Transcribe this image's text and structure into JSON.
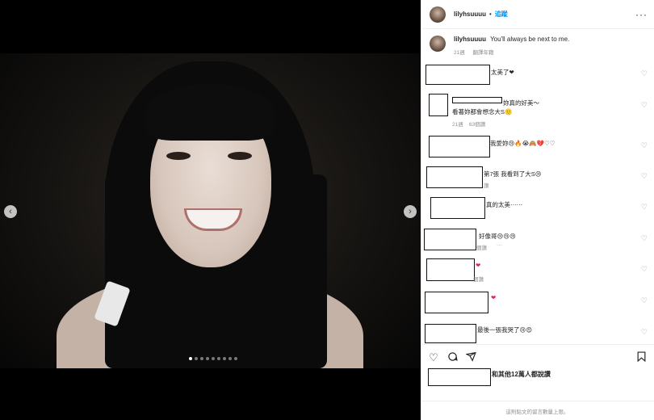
{
  "media": {
    "nav": {
      "prev_icon": "chevron-left-icon",
      "next_icon": "chevron-right-icon",
      "prev": "‹",
      "next": "›"
    },
    "carousel": {
      "count": 9,
      "active_index": 0
    }
  },
  "header": {
    "username": "lilyhsuuuu",
    "separator": "•",
    "follow_label": "追蹤",
    "more": "···"
  },
  "caption": {
    "username": "lilyhsuuuu",
    "text": "You'll always be next to me.",
    "age": "21週",
    "translate": "翻譯年籍"
  },
  "comments": [
    {
      "text": "太美了❤",
      "meta": ""
    },
    {
      "text": "妳真的好美～",
      "text2": "看著妳都會想念大S🙂",
      "meta_age": "21週",
      "meta_likes": "63個讚"
    },
    {
      "text": "我愛妳😢🔥😭🙈💔♡♡",
      "meta": ""
    },
    {
      "text": "第7張 我看到了大S😢",
      "meta": "讚"
    },
    {
      "text": "真的太美⋯⋯",
      "meta": ""
    },
    {
      "text": "好像哥😢😢😢",
      "meta": "個讚",
      "meta_more": "···"
    },
    {
      "text": "❤",
      "meta": "個讚"
    },
    {
      "text": "❤",
      "meta": ""
    },
    {
      "text": "最後一張我哭了😢😍",
      "meta": ""
    }
  ],
  "actions": {
    "like_icon": "heart-icon",
    "comment_icon": "comment-icon",
    "share_icon": "share-icon",
    "save_icon": "bookmark-icon"
  },
  "likes": {
    "text": "和其他12萬人都說讚"
  },
  "footer": {
    "text": "這則貼文的留言數量上限。"
  },
  "colors": {
    "accent": "#0095f6",
    "heart": "#e0245e",
    "muted": "#8e8e8e"
  }
}
